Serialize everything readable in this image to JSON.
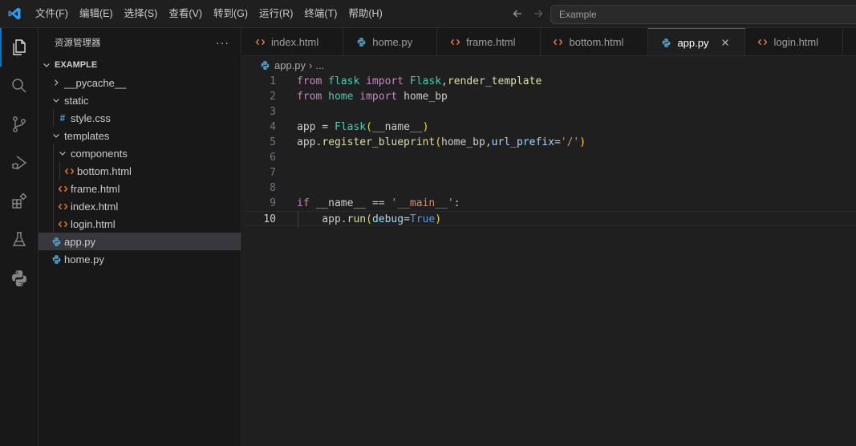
{
  "menu": [
    "文件(F)",
    "编辑(E)",
    "选择(S)",
    "查看(V)",
    "转到(G)",
    "运行(R)",
    "终端(T)",
    "帮助(H)"
  ],
  "command_center": "Example",
  "activity_icons": [
    "files-icon",
    "search-icon",
    "source-control-icon",
    "run-debug-icon",
    "extensions-icon",
    "testing-icon",
    "python-icon"
  ],
  "sidebar": {
    "title": "资源管理器",
    "more": "···",
    "tree": [
      {
        "label": "EXAMPLE",
        "kind": "root",
        "depth": 0,
        "chevron": "down"
      },
      {
        "label": "__pycache__",
        "kind": "folder",
        "depth": 1,
        "chevron": "right"
      },
      {
        "label": "static",
        "kind": "folder",
        "depth": 1,
        "chevron": "down"
      },
      {
        "label": "style.css",
        "kind": "css",
        "depth": 2
      },
      {
        "label": "templates",
        "kind": "folder",
        "depth": 1,
        "chevron": "down"
      },
      {
        "label": "components",
        "kind": "folder",
        "depth": 2,
        "chevron": "down"
      },
      {
        "label": "bottom.html",
        "kind": "html",
        "depth": 3
      },
      {
        "label": "frame.html",
        "kind": "html",
        "depth": 2
      },
      {
        "label": "index.html",
        "kind": "html",
        "depth": 2
      },
      {
        "label": "login.html",
        "kind": "html",
        "depth": 2
      },
      {
        "label": "app.py",
        "kind": "py",
        "depth": 1,
        "selected": true
      },
      {
        "label": "home.py",
        "kind": "py",
        "depth": 1
      }
    ]
  },
  "tabs": [
    {
      "label": "index.html",
      "kind": "html"
    },
    {
      "label": "home.py",
      "kind": "py"
    },
    {
      "label": "frame.html",
      "kind": "html"
    },
    {
      "label": "bottom.html",
      "kind": "html"
    },
    {
      "label": "app.py",
      "kind": "py",
      "active": true
    },
    {
      "label": "login.html",
      "kind": "html"
    }
  ],
  "breadcrumb": {
    "file": "app.py",
    "rest": "..."
  },
  "editor": {
    "current_line": 10,
    "lines": [
      {
        "n": "1",
        "tokens": [
          [
            "from",
            "kw"
          ],
          [
            " ",
            "var"
          ],
          [
            "flask",
            "mod"
          ],
          [
            " ",
            "var"
          ],
          [
            "import",
            "kw"
          ],
          [
            " ",
            "var"
          ],
          [
            "Flask",
            "cls"
          ],
          [
            ",",
            "op"
          ],
          [
            "render_template",
            "fn"
          ]
        ]
      },
      {
        "n": "2",
        "tokens": [
          [
            "from",
            "kw"
          ],
          [
            " ",
            "var"
          ],
          [
            "home",
            "mod"
          ],
          [
            " ",
            "var"
          ],
          [
            "import",
            "kw"
          ],
          [
            " ",
            "var"
          ],
          [
            "home_bp",
            "var"
          ]
        ]
      },
      {
        "n": "3",
        "tokens": []
      },
      {
        "n": "4",
        "tokens": [
          [
            "app",
            "var"
          ],
          [
            " = ",
            "op"
          ],
          [
            "Flask",
            "cls"
          ],
          [
            "(",
            "br1"
          ],
          [
            "__name__",
            "var"
          ],
          [
            ")",
            "br1"
          ]
        ]
      },
      {
        "n": "5",
        "tokens": [
          [
            "app",
            "var"
          ],
          [
            ".",
            "op"
          ],
          [
            "register_blueprint",
            "fn"
          ],
          [
            "(",
            "br1"
          ],
          [
            "home_bp",
            "var"
          ],
          [
            ",",
            "op"
          ],
          [
            "url_prefix",
            "param"
          ],
          [
            "=",
            "op"
          ],
          [
            "'/'",
            "str"
          ],
          [
            ")",
            "br1"
          ]
        ]
      },
      {
        "n": "6",
        "tokens": []
      },
      {
        "n": "7",
        "tokens": []
      },
      {
        "n": "8",
        "tokens": []
      },
      {
        "n": "9",
        "tokens": [
          [
            "if",
            "kw"
          ],
          [
            " __name__ ",
            "var"
          ],
          [
            "==",
            "op"
          ],
          [
            " ",
            "var"
          ],
          [
            "'__main__'",
            "str"
          ],
          [
            ":",
            "op"
          ]
        ]
      },
      {
        "n": "10",
        "tokens": [
          [
            "    app",
            "var"
          ],
          [
            ".",
            "op"
          ],
          [
            "run",
            "fn"
          ],
          [
            "(",
            "br1"
          ],
          [
            "debug",
            "param"
          ],
          [
            "=",
            "op"
          ],
          [
            "True",
            "const"
          ],
          [
            ")",
            "br1"
          ]
        ]
      }
    ]
  },
  "colors": {
    "accent": "#0078d4",
    "html_icon": "#e37933",
    "py_icon": "#519aba",
    "css_icon": "#42a5f5"
  }
}
